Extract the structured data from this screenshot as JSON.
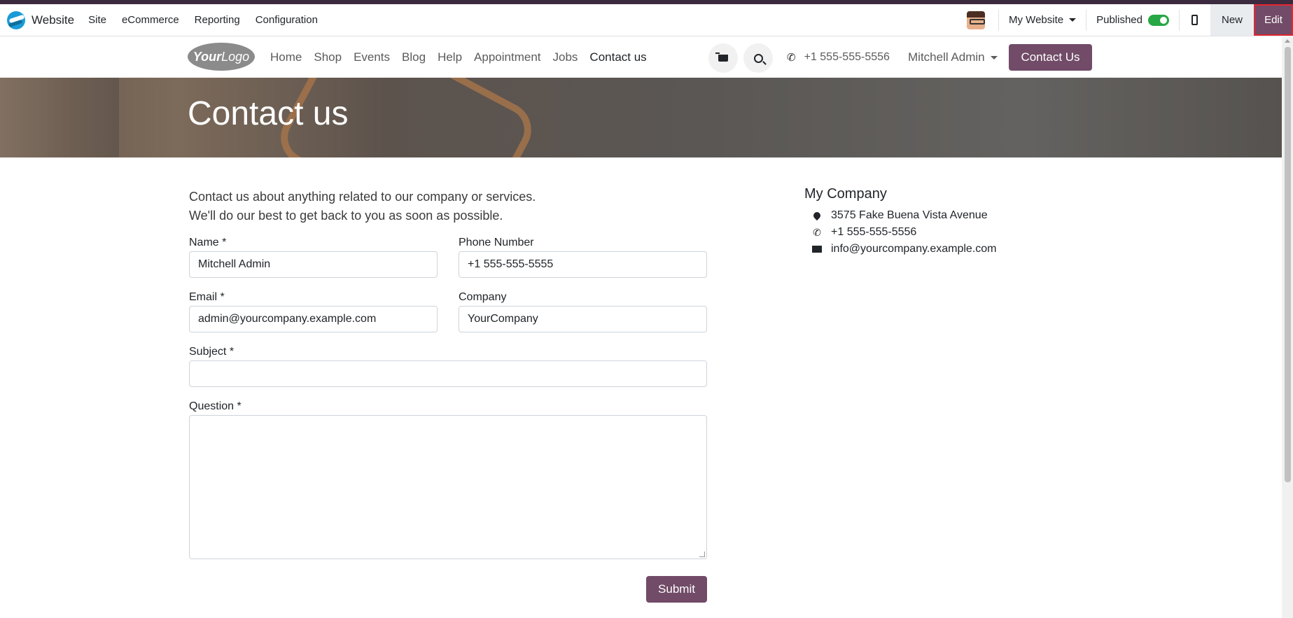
{
  "backend_nav": {
    "app_name": "Website",
    "menu": [
      "Site",
      "eCommerce",
      "Reporting",
      "Configuration"
    ],
    "website_selector": "My Website",
    "published_label": "Published",
    "published": true,
    "new_label": "New",
    "edit_label": "Edit"
  },
  "site_header": {
    "logo_text_bold": "Your",
    "logo_text": "Logo",
    "menu": [
      {
        "label": "Home",
        "active": false
      },
      {
        "label": "Shop",
        "active": false
      },
      {
        "label": "Events",
        "active": false
      },
      {
        "label": "Blog",
        "active": false
      },
      {
        "label": "Help",
        "active": false
      },
      {
        "label": "Appointment",
        "active": false
      },
      {
        "label": "Jobs",
        "active": false
      },
      {
        "label": "Contact us",
        "active": true
      }
    ],
    "phone": "+1 555-555-5556",
    "user": "Mitchell Admin",
    "cta_label": "Contact Us"
  },
  "banner": {
    "title": "Contact us"
  },
  "intro": {
    "line1": "Contact us about anything related to our company or services.",
    "line2": "We'll do our best to get back to you as soon as possible."
  },
  "form": {
    "name_label": "Name *",
    "name_value": "Mitchell Admin",
    "phone_label": "Phone Number",
    "phone_value": "+1 555-555-5555",
    "email_label": "Email *",
    "email_value": "admin@yourcompany.example.com",
    "company_label": "Company",
    "company_value": "YourCompany",
    "subject_label": "Subject *",
    "subject_value": "",
    "question_label": "Question *",
    "question_value": "",
    "submit_label": "Submit"
  },
  "company": {
    "name": "My Company",
    "address": "3575 Fake Buena Vista Avenue",
    "phone": "+1 555-555-5556",
    "email": "info@yourcompany.example.com"
  },
  "colors": {
    "brand": "#714b67",
    "toggle_on": "#28a745",
    "highlight": "#e3262f"
  }
}
